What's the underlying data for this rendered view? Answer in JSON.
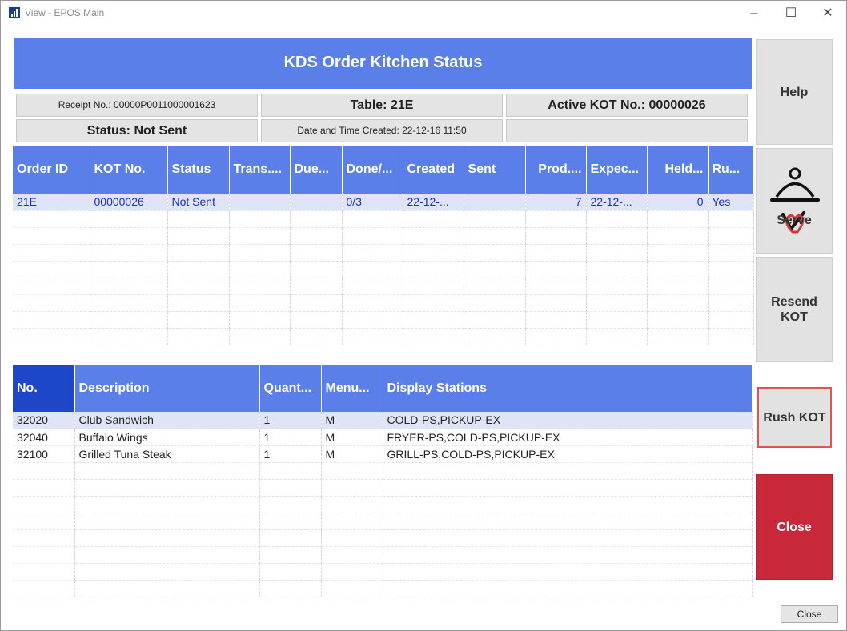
{
  "window": {
    "title": "View - EPOS Main"
  },
  "header": {
    "title": "KDS Order Kitchen Status"
  },
  "info": {
    "receipt": "Receipt No.: 00000P0011000001623",
    "table": "Table:  21E",
    "active_kot": "Active KOT No.: 00000026",
    "status": "Status: Not Sent",
    "created": "Date and Time Created: 22-12-16 11:50",
    "blank": ""
  },
  "orders": {
    "columns": [
      "Order ID",
      "KOT No.",
      "Status",
      "Trans....",
      "Due...",
      "Done/...",
      "Created",
      "Sent",
      "Prod....",
      "Expec...",
      "Held...",
      "Ru..."
    ],
    "rows": [
      [
        "21E",
        "00000026",
        "Not Sent",
        "",
        "",
        "0/3",
        "22-12-...",
        "",
        "7",
        "22-12-...",
        "0",
        "Yes"
      ]
    ]
  },
  "items": {
    "columns": [
      "No.",
      "Description",
      "Quant...",
      "Menu...",
      "Display Stations"
    ],
    "rows": [
      [
        "32020",
        "Club Sandwich",
        "1",
        "M",
        "COLD-PS,PICKUP-EX"
      ],
      [
        "32040",
        "Buffalo Wings",
        "1",
        "M",
        "FRYER-PS,COLD-PS,PICKUP-EX"
      ],
      [
        "32100",
        "Grilled Tuna Steak",
        "1",
        "M",
        "GRILL-PS,COLD-PS,PICKUP-EX"
      ]
    ]
  },
  "side_buttons": {
    "help": "Help",
    "serve": "Serve",
    "resend_kot": "Resend KOT",
    "rush_kot": "Rush KOT",
    "close": "Close"
  },
  "footer": {
    "close": "Close"
  },
  "colors": {
    "accent": "#5b7fe8",
    "close_red": "#c8283a",
    "rush_border": "#e0544f",
    "row_text": "#1a2fc8"
  }
}
